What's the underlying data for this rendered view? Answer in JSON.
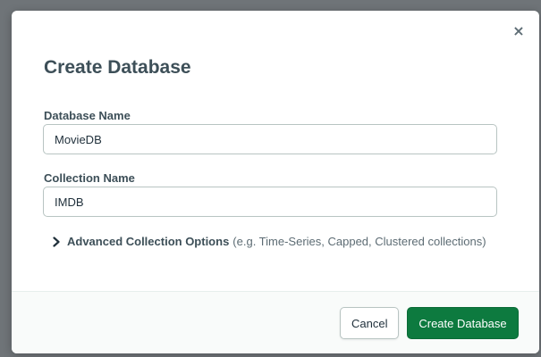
{
  "dialog": {
    "title": "Create Database",
    "close_symbol": "×"
  },
  "database_name": {
    "label": "Database Name",
    "value": "MovieDB"
  },
  "collection_name": {
    "label": "Collection Name",
    "value": "IMDB"
  },
  "advanced_options": {
    "label": "Advanced Collection Options",
    "hint": "(e.g. Time-Series, Capped, Clustered collections)",
    "icon": "chevron-right-icon"
  },
  "footer": {
    "cancel_label": "Cancel",
    "submit_label": "Create Database"
  },
  "colors": {
    "primary_button": "#0d7a3f",
    "heading_text": "#3d4f58",
    "backdrop": "#6f7478"
  }
}
